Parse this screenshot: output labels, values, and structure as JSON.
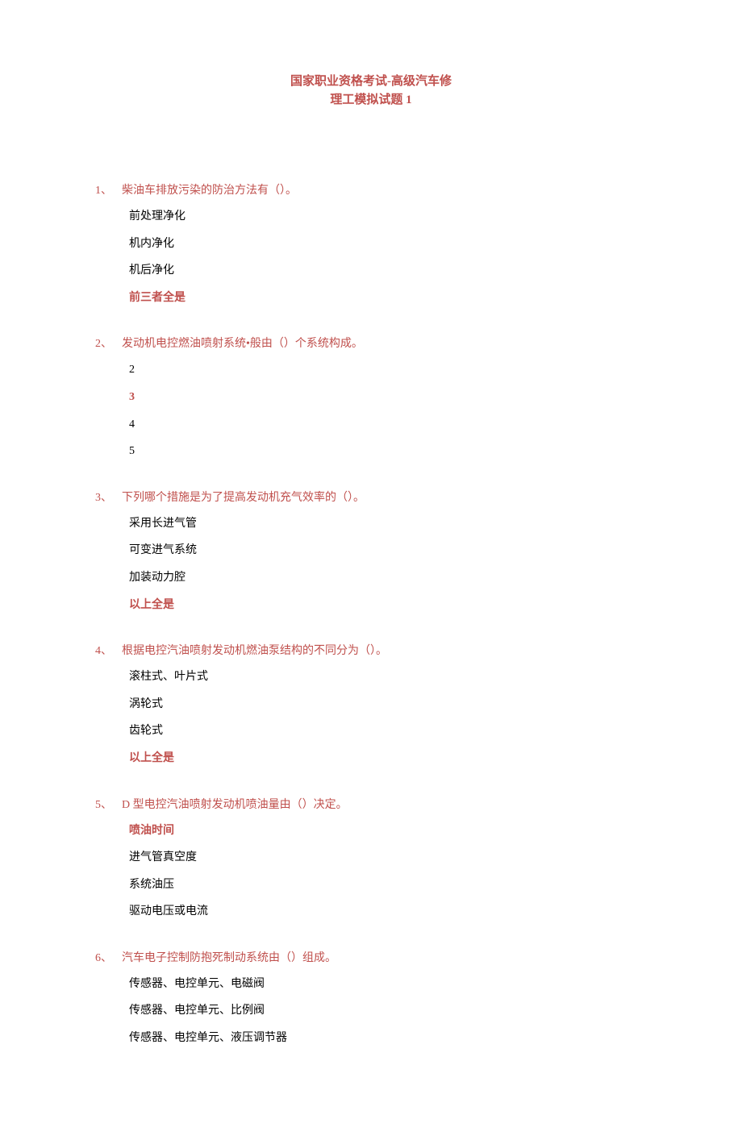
{
  "title_line1": "国家职业资格考试-高级汽车修",
  "title_line2": "理工模拟试题 1",
  "questions": [
    {
      "num": "1、",
      "text": "柴油车排放污染的防治方法有（）。",
      "options": [
        {
          "text": "前处理净化",
          "correct": false
        },
        {
          "text": "机内净化",
          "correct": false
        },
        {
          "text": "机后净化",
          "correct": false
        },
        {
          "text": "前三者全是",
          "correct": true
        }
      ]
    },
    {
      "num": "2、",
      "text": "发动机电控燃油喷射系统•般由（）个系统构成。",
      "options": [
        {
          "text": "2",
          "correct": false
        },
        {
          "text": "3",
          "correct": true
        },
        {
          "text": "4",
          "correct": false
        },
        {
          "text": "5",
          "correct": false
        }
      ]
    },
    {
      "num": "3、",
      "text": "下列哪个措施是为了提高发动机充气效率的（）。",
      "options": [
        {
          "text": "采用长进气管",
          "correct": false
        },
        {
          "text": "可变进气系统",
          "correct": false
        },
        {
          "text": "加装动力腔",
          "correct": false
        },
        {
          "text": "以上全是",
          "correct": true
        }
      ]
    },
    {
      "num": "4、",
      "text": "根据电控汽油喷射发动机燃油泵结构的不同分为（）。",
      "options": [
        {
          "text": "滚柱式、叶片式",
          "correct": false
        },
        {
          "text": "涡轮式",
          "correct": false
        },
        {
          "text": "齿轮式",
          "correct": false
        },
        {
          "text": "以上全是",
          "correct": true
        }
      ]
    },
    {
      "num": "5、",
      "text": "D 型电控汽油喷射发动机喷油量由（）决定。",
      "options": [
        {
          "text": "喷油时间",
          "correct": true
        },
        {
          "text": "进气管真空度",
          "correct": false
        },
        {
          "text": "系统油压",
          "correct": false
        },
        {
          "text": "驱动电压或电流",
          "correct": false
        }
      ]
    },
    {
      "num": "6、",
      "text": "汽车电子控制防抱死制动系统由（）组成。",
      "options": [
        {
          "text": "传感器、电控单元、电磁阀",
          "correct": false
        },
        {
          "text": "传感器、电控单元、比例阀",
          "correct": false
        },
        {
          "text": "传感器、电控单元、液压调节器",
          "correct": false
        }
      ]
    }
  ]
}
